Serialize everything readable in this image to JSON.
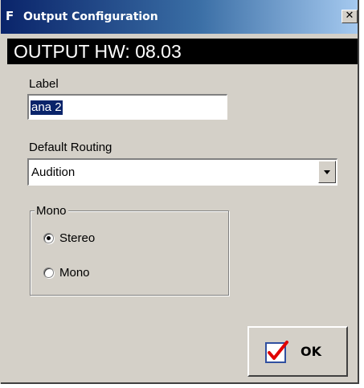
{
  "window": {
    "title": "Output Configuration",
    "app_icon_letter": "F",
    "close_glyph": "✕"
  },
  "banner": {
    "text": "OUTPUT HW: 08.03"
  },
  "label_field": {
    "label": "Label",
    "value": "ana 2"
  },
  "routing": {
    "label": "Default Routing",
    "selected": "Audition"
  },
  "mono_group": {
    "legend": "Mono",
    "options": [
      {
        "label": "Stereo",
        "checked": true
      },
      {
        "label": "Mono",
        "checked": false
      }
    ]
  },
  "ok_button": {
    "label": "OK",
    "icon": "red-checkmark-icon",
    "check_color": "#e00000",
    "box_color": "#3050a0"
  },
  "colors": {
    "titlebar_start": "#0a246a",
    "titlebar_end": "#a6caf0",
    "dialog_bg": "#d4d0c8",
    "banner_bg": "#000000"
  }
}
